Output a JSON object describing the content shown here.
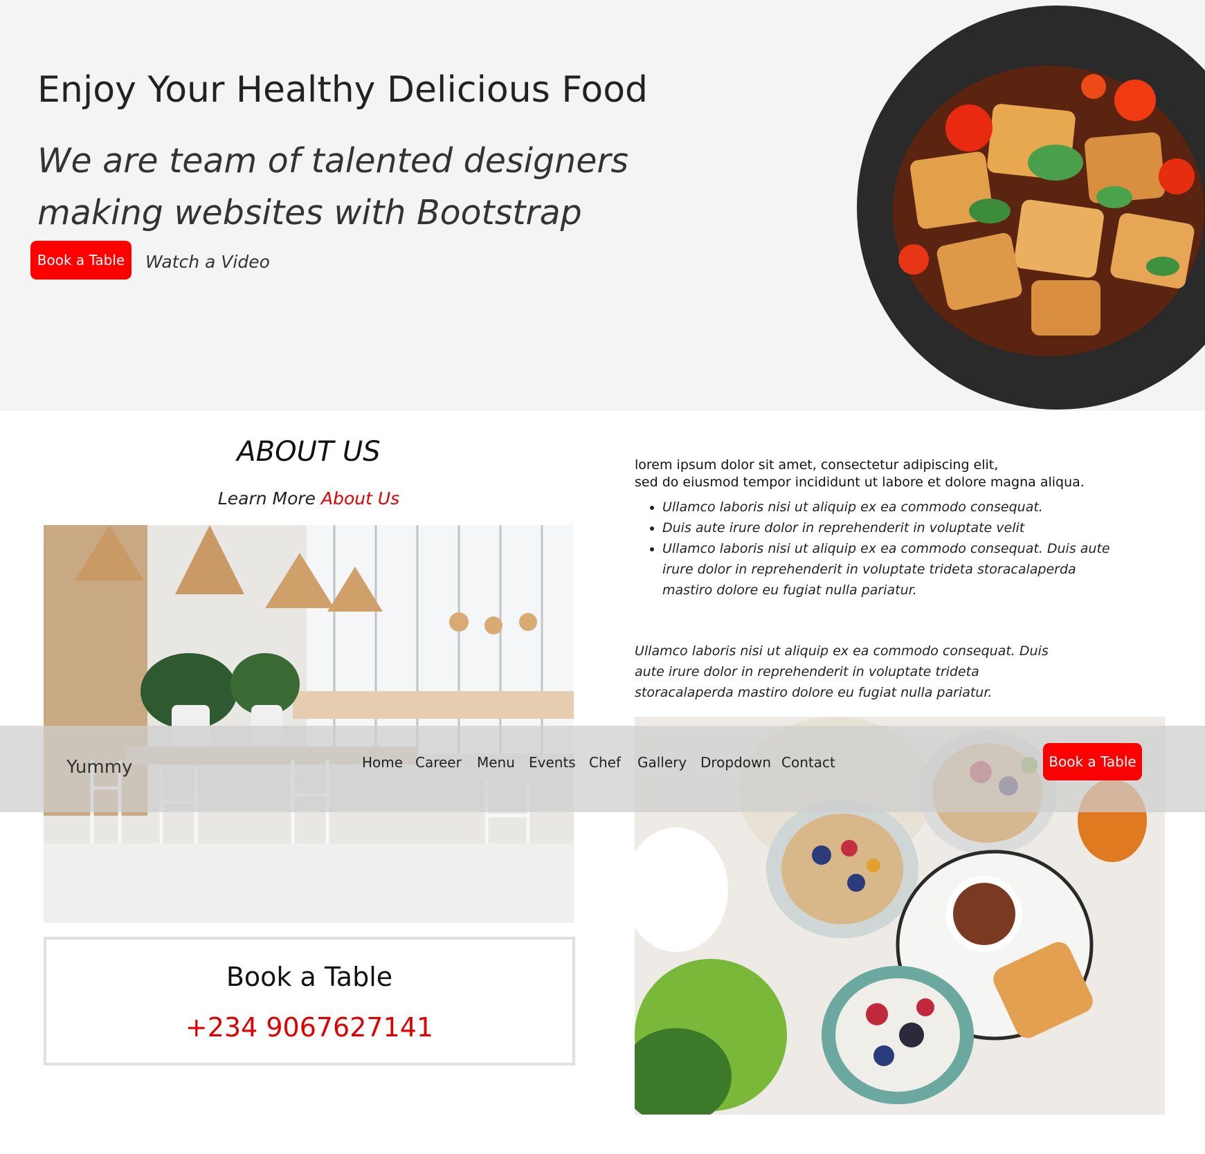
{
  "hero": {
    "title": "Enjoy Your Healthy Delicious Food",
    "subtitle": "We are team of talented designers making websites with Bootstrap",
    "book_button": "Book a Table",
    "watch_video": "Watch a Video"
  },
  "about": {
    "title": "ABOUT US",
    "learn_prefix": "Learn More",
    "learn_accent": "About Us",
    "intro_line1": "lorem ipsum dolor sit amet, consectetur adipiscing elit,",
    "intro_line2": "sed do eiusmod tempor incididunt ut labore et dolore magna aliqua.",
    "bullets": [
      "Ullamco laboris nisi ut aliquip ex ea commodo consequat.",
      "Duis aute irure dolor in reprehenderit in voluptate velit",
      "Ullamco laboris nisi ut aliquip ex ea commodo consequat. Duis aute irure dolor in reprehenderit in voluptate trideta storacalaperda mastiro dolore eu fugiat nulla pariatur."
    ],
    "paragraph": "Ullamco laboris nisi ut aliquip ex ea commodo consequat. Duis aute irure dolor in reprehenderit in voluptate trideta storacalaperda mastiro dolore eu fugiat nulla pariatur.",
    "book_card_title": "Book a Table",
    "book_card_phone": "+234 9067627141"
  },
  "navbar": {
    "brand": "Yummy",
    "items": [
      "Home",
      "Career",
      "Menu",
      "Events",
      "Chef",
      "Gallery",
      "Dropdown",
      "Contact"
    ],
    "book_button": "Book a Table"
  },
  "colors": {
    "accent": "#ff0000",
    "hero_bg": "#f4f4f5"
  }
}
